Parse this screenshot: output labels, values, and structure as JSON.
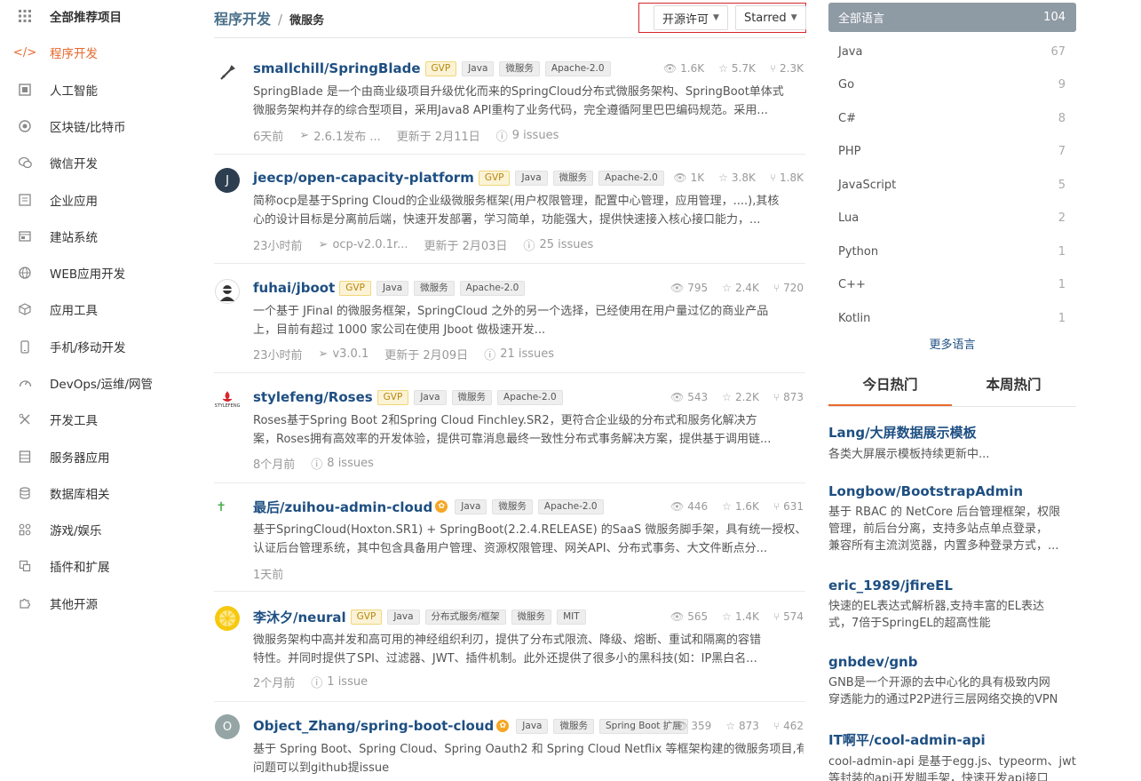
{
  "sidebar": {
    "items": [
      {
        "label": "全部推荐项目",
        "icon": "grid-icon"
      },
      {
        "label": "程序开发",
        "icon": "code-icon"
      },
      {
        "label": "人工智能",
        "icon": "ai-icon"
      },
      {
        "label": "区块链/比特币",
        "icon": "coin-icon"
      },
      {
        "label": "微信开发",
        "icon": "wechat-icon"
      },
      {
        "label": "企业应用",
        "icon": "building-icon"
      },
      {
        "label": "建站系统",
        "icon": "site-icon"
      },
      {
        "label": "WEB应用开发",
        "icon": "globe-icon"
      },
      {
        "label": "应用工具",
        "icon": "box-icon"
      },
      {
        "label": "手机/移动开发",
        "icon": "phone-icon"
      },
      {
        "label": "DevOps/运维/网管",
        "icon": "gauge-icon"
      },
      {
        "label": "开发工具",
        "icon": "tools-icon"
      },
      {
        "label": "服务器应用",
        "icon": "server-icon"
      },
      {
        "label": "数据库相关",
        "icon": "database-icon"
      },
      {
        "label": "游戏/娱乐",
        "icon": "game-icon"
      },
      {
        "label": "插件和扩展",
        "icon": "plugin-icon"
      },
      {
        "label": "其他开源",
        "icon": "puzzle-icon"
      }
    ]
  },
  "breadcrumb": {
    "root": "程序开发",
    "sep": "/",
    "current": "微服务"
  },
  "filters": {
    "license": "开源许可",
    "sort": "Starred"
  },
  "projects": [
    {
      "name": "smallchill/SpringBlade",
      "avatar_text": "",
      "badges": [
        "GVP",
        "Java",
        "微服务",
        "Apache-2.0"
      ],
      "views": "1.6K",
      "stars": "5.7K",
      "forks": "2.3K",
      "desc": [
        "SpringBlade 是一个由商业级项目升级优化而来的SpringCloud分布式微服务架构、SpringBoot单体式",
        "微服务架构并存的综合型项目，采用Java8 API重构了业务代码，完全遵循阿里巴巴编码规范。采用..."
      ],
      "meta": [
        "6天前",
        "2.6.1发布 ...",
        "更新于 2月11日",
        "9 issues"
      ]
    },
    {
      "name": "jeecp/open-capacity-platform",
      "avatar_text": "J",
      "badges": [
        "GVP",
        "Java",
        "微服务",
        "Apache-2.0"
      ],
      "views": "1K",
      "stars": "3.8K",
      "forks": "1.8K",
      "desc": [
        "简称ocp是基于Spring Cloud的企业级微服务框架(用户权限管理，配置中心管理，应用管理，....),其核",
        "心的设计目标是分离前后端，快速开发部署，学习简单，功能强大，提供快速接入核心接口能力，..."
      ],
      "meta": [
        "23小时前",
        "ocp-v2.0.1r...",
        "更新于 2月03日",
        "25 issues"
      ]
    },
    {
      "name": "fuhai/jboot",
      "avatar_text": "",
      "badges": [
        "GVP",
        "Java",
        "微服务",
        "Apache-2.0"
      ],
      "views": "795",
      "stars": "2.4K",
      "forks": "720",
      "desc": [
        "一个基于 JFinal 的微服务框架，SpringCloud 之外的另一个选择，已经使用在用户量过亿的商业产品",
        "上，目前有超过 1000 家公司在使用 Jboot 做极速开发..."
      ],
      "meta": [
        "23小时前",
        "v3.0.1",
        "更新于 2月09日",
        "21 issues"
      ]
    },
    {
      "name": "stylefeng/Roses",
      "avatar_text": "STYLEFENG",
      "badges": [
        "GVP",
        "Java",
        "微服务",
        "Apache-2.0"
      ],
      "views": "543",
      "stars": "2.2K",
      "forks": "873",
      "desc": [
        "Roses基于Spring Boot 2和Spring Cloud Finchley.SR2，更符合企业级的分布式和服务化解决方",
        "案，Roses拥有高效率的开发体验，提供可靠消息最终一致性分布式事务解决方案，提供基于调用链..."
      ],
      "meta": [
        "8个月前",
        "8 issues"
      ]
    },
    {
      "name": "最后/zuihou-admin-cloud",
      "avatar_text": "",
      "badges": [
        "Java",
        "微服务",
        "Apache-2.0"
      ],
      "views": "446",
      "stars": "1.6K",
      "forks": "631",
      "desc": [
        "基于SpringCloud(Hoxton.SR1) + SpringBoot(2.2.4.RELEASE) 的SaaS 微服务脚手架，具有统一授权、",
        "认证后台管理系统，其中包含具备用户管理、资源权限管理、网关API、分布式事务、大文件断点分..."
      ],
      "meta": [
        "1天前"
      ]
    },
    {
      "name": "李沐夕/neural",
      "avatar_text": "",
      "badges": [
        "GVP",
        "Java",
        "分布式服务/框架",
        "微服务",
        "MIT"
      ],
      "views": "565",
      "stars": "1.4K",
      "forks": "574",
      "desc": [
        "微服务架构中高并发和高可用的神经组织利刃，提供了分布式限流、降级、熔断、重试和隔离的容错",
        "特性。并同时提供了SPI、过滤器、JWT、插件机制。此外还提供了很多小的黑科技(如：IP黑白名..."
      ],
      "meta": [
        "2个月前",
        "1 issue"
      ]
    },
    {
      "name": "Object_Zhang/spring-boot-cloud",
      "avatar_text": "O",
      "badges": [
        "Java",
        "微服务",
        "Spring Boot 扩展"
      ],
      "views": "359",
      "stars": "873",
      "forks": "462",
      "desc": [
        "基于 Spring Boot、Spring Cloud、Spring Oauth2 和 Spring Cloud Netflix 等框架构建的微服务项目,有",
        "问题可以到github提issue"
      ],
      "meta": []
    }
  ],
  "languages": {
    "all": {
      "name": "全部语言",
      "count": "104"
    },
    "items": [
      {
        "name": "Java",
        "count": "67"
      },
      {
        "name": "Go",
        "count": "9"
      },
      {
        "name": "C#",
        "count": "8"
      },
      {
        "name": "PHP",
        "count": "7"
      },
      {
        "name": "JavaScript",
        "count": "5"
      },
      {
        "name": "Lua",
        "count": "2"
      },
      {
        "name": "Python",
        "count": "1"
      },
      {
        "name": "C++",
        "count": "1"
      },
      {
        "name": "Kotlin",
        "count": "1"
      }
    ],
    "more": "更多语言"
  },
  "hot_tabs": [
    "今日热门",
    "本周热门"
  ],
  "hot": [
    {
      "title": "Lang/大屏数据展示模板",
      "desc": [
        "各类大屏展示模板持续更新中..."
      ]
    },
    {
      "title": "Longbow/BootstrapAdmin",
      "desc": [
        "基于 RBAC 的 NetCore 后台管理框架，权限",
        "管理，前后台分离，支持多站点单点登录，",
        "兼容所有主流浏览器，内置多种登录方式，..."
      ]
    },
    {
      "title": "eric_1989/jfireEL",
      "desc": [
        "快速的EL表达式解析器,支持丰富的EL表达",
        "式，7倍于SpringEL的超高性能"
      ]
    },
    {
      "title": "gnbdev/gnb",
      "desc": [
        "GNB是一个开源的去中心化的具有极致内网",
        "穿透能力的通过P2P进行三层网络交换的VPN"
      ]
    },
    {
      "title": "IT啊平/cool-admin-api",
      "desc": [
        "cool-admin-api 是基于egg.js、typeorm、jwt",
        "等封装的api开发脚手架，快速开发api接口"
      ]
    }
  ],
  "colors": {
    "accent": "#e8692d",
    "link": "#1e4f82",
    "filter_outline": "#d7262c",
    "lang_selected_bg": "#8e9aa4"
  }
}
